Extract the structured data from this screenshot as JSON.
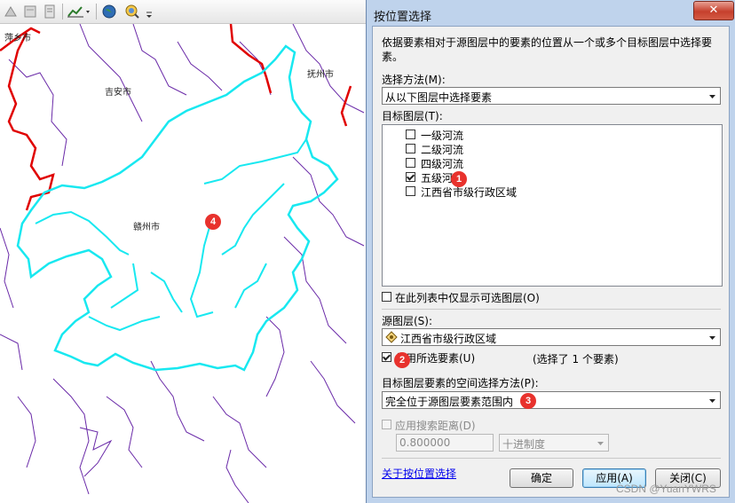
{
  "toolbar": {
    "icons": [
      "pointer-tools-icon",
      "layer-icon",
      "report-icon",
      "chart-icon",
      "globe-icon",
      "search-globe-icon",
      "overflow-icon"
    ]
  },
  "map": {
    "city_labels": [
      "萍乡市",
      "吉安市",
      "抚州市",
      "赣州市"
    ],
    "markers": [
      "4"
    ],
    "colors": {
      "province_boundary": "#e00000",
      "selected_region": "#18e8f0",
      "rivers": "#6a2aa8"
    }
  },
  "dialog": {
    "title": "按位置选择",
    "close_symbol": "✕",
    "description": "依据要素相对于源图层中的要素的位置从一个或多个目标图层中选择要素。",
    "selection_method_label": "选择方法(M):",
    "selection_method_value": "从以下图层中选择要素",
    "target_layers_label": "目标图层(T):",
    "target_layers": [
      {
        "label": "一级河流",
        "checked": false
      },
      {
        "label": "二级河流",
        "checked": false
      },
      {
        "label": "四级河流",
        "checked": false
      },
      {
        "label": "五级河流",
        "checked": true
      },
      {
        "label": "江西省市级行政区域",
        "checked": false
      }
    ],
    "only_selectable_label": "在此列表中仅显示可选图层(O)",
    "source_layer_label": "源图层(S):",
    "source_layer_value": "江西省市级行政区域",
    "use_selected_label": "使用所选要素(U)",
    "selected_count_text": "(选择了 1 个要素)",
    "spatial_method_label": "目标图层要素的空间选择方法(P):",
    "spatial_method_value": "完全位于源图层要素范围内",
    "apply_distance_label": "应用搜索距离(D)",
    "distance_value": "0.800000",
    "distance_unit": "十进制度",
    "help_link": "关于按位置选择",
    "ok_label": "确定",
    "apply_label": "应用(A)",
    "close_label": "关闭(C)",
    "markers": [
      "1",
      "2",
      "3"
    ]
  },
  "watermark": "CSDN @YuanYWRS"
}
